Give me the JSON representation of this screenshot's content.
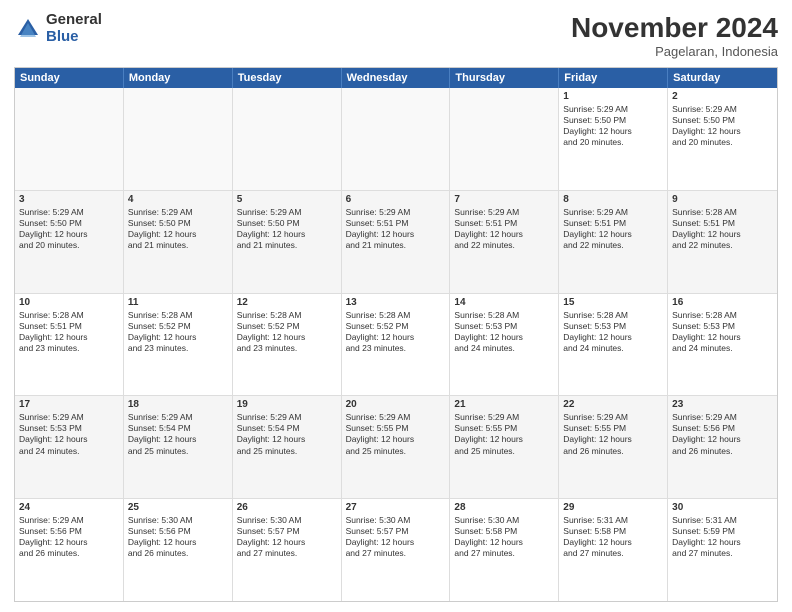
{
  "logo": {
    "general": "General",
    "blue": "Blue"
  },
  "header": {
    "title": "November 2024",
    "subtitle": "Pagelaran, Indonesia"
  },
  "weekdays": [
    "Sunday",
    "Monday",
    "Tuesday",
    "Wednesday",
    "Thursday",
    "Friday",
    "Saturday"
  ],
  "rows": [
    {
      "cells": [
        {
          "day": "",
          "text": "",
          "empty": true
        },
        {
          "day": "",
          "text": "",
          "empty": true
        },
        {
          "day": "",
          "text": "",
          "empty": true
        },
        {
          "day": "",
          "text": "",
          "empty": true
        },
        {
          "day": "",
          "text": "",
          "empty": true
        },
        {
          "day": "1",
          "text": "Sunrise: 5:29 AM\nSunset: 5:50 PM\nDaylight: 12 hours\nand 20 minutes.",
          "empty": false
        },
        {
          "day": "2",
          "text": "Sunrise: 5:29 AM\nSunset: 5:50 PM\nDaylight: 12 hours\nand 20 minutes.",
          "empty": false
        }
      ]
    },
    {
      "cells": [
        {
          "day": "3",
          "text": "Sunrise: 5:29 AM\nSunset: 5:50 PM\nDaylight: 12 hours\nand 20 minutes.",
          "empty": false
        },
        {
          "day": "4",
          "text": "Sunrise: 5:29 AM\nSunset: 5:50 PM\nDaylight: 12 hours\nand 21 minutes.",
          "empty": false
        },
        {
          "day": "5",
          "text": "Sunrise: 5:29 AM\nSunset: 5:50 PM\nDaylight: 12 hours\nand 21 minutes.",
          "empty": false
        },
        {
          "day": "6",
          "text": "Sunrise: 5:29 AM\nSunset: 5:51 PM\nDaylight: 12 hours\nand 21 minutes.",
          "empty": false
        },
        {
          "day": "7",
          "text": "Sunrise: 5:29 AM\nSunset: 5:51 PM\nDaylight: 12 hours\nand 22 minutes.",
          "empty": false
        },
        {
          "day": "8",
          "text": "Sunrise: 5:29 AM\nSunset: 5:51 PM\nDaylight: 12 hours\nand 22 minutes.",
          "empty": false
        },
        {
          "day": "9",
          "text": "Sunrise: 5:28 AM\nSunset: 5:51 PM\nDaylight: 12 hours\nand 22 minutes.",
          "empty": false
        }
      ]
    },
    {
      "cells": [
        {
          "day": "10",
          "text": "Sunrise: 5:28 AM\nSunset: 5:51 PM\nDaylight: 12 hours\nand 23 minutes.",
          "empty": false
        },
        {
          "day": "11",
          "text": "Sunrise: 5:28 AM\nSunset: 5:52 PM\nDaylight: 12 hours\nand 23 minutes.",
          "empty": false
        },
        {
          "day": "12",
          "text": "Sunrise: 5:28 AM\nSunset: 5:52 PM\nDaylight: 12 hours\nand 23 minutes.",
          "empty": false
        },
        {
          "day": "13",
          "text": "Sunrise: 5:28 AM\nSunset: 5:52 PM\nDaylight: 12 hours\nand 23 minutes.",
          "empty": false
        },
        {
          "day": "14",
          "text": "Sunrise: 5:28 AM\nSunset: 5:53 PM\nDaylight: 12 hours\nand 24 minutes.",
          "empty": false
        },
        {
          "day": "15",
          "text": "Sunrise: 5:28 AM\nSunset: 5:53 PM\nDaylight: 12 hours\nand 24 minutes.",
          "empty": false
        },
        {
          "day": "16",
          "text": "Sunrise: 5:28 AM\nSunset: 5:53 PM\nDaylight: 12 hours\nand 24 minutes.",
          "empty": false
        }
      ]
    },
    {
      "cells": [
        {
          "day": "17",
          "text": "Sunrise: 5:29 AM\nSunset: 5:53 PM\nDaylight: 12 hours\nand 24 minutes.",
          "empty": false
        },
        {
          "day": "18",
          "text": "Sunrise: 5:29 AM\nSunset: 5:54 PM\nDaylight: 12 hours\nand 25 minutes.",
          "empty": false
        },
        {
          "day": "19",
          "text": "Sunrise: 5:29 AM\nSunset: 5:54 PM\nDaylight: 12 hours\nand 25 minutes.",
          "empty": false
        },
        {
          "day": "20",
          "text": "Sunrise: 5:29 AM\nSunset: 5:55 PM\nDaylight: 12 hours\nand 25 minutes.",
          "empty": false
        },
        {
          "day": "21",
          "text": "Sunrise: 5:29 AM\nSunset: 5:55 PM\nDaylight: 12 hours\nand 25 minutes.",
          "empty": false
        },
        {
          "day": "22",
          "text": "Sunrise: 5:29 AM\nSunset: 5:55 PM\nDaylight: 12 hours\nand 26 minutes.",
          "empty": false
        },
        {
          "day": "23",
          "text": "Sunrise: 5:29 AM\nSunset: 5:56 PM\nDaylight: 12 hours\nand 26 minutes.",
          "empty": false
        }
      ]
    },
    {
      "cells": [
        {
          "day": "24",
          "text": "Sunrise: 5:29 AM\nSunset: 5:56 PM\nDaylight: 12 hours\nand 26 minutes.",
          "empty": false
        },
        {
          "day": "25",
          "text": "Sunrise: 5:30 AM\nSunset: 5:56 PM\nDaylight: 12 hours\nand 26 minutes.",
          "empty": false
        },
        {
          "day": "26",
          "text": "Sunrise: 5:30 AM\nSunset: 5:57 PM\nDaylight: 12 hours\nand 27 minutes.",
          "empty": false
        },
        {
          "day": "27",
          "text": "Sunrise: 5:30 AM\nSunset: 5:57 PM\nDaylight: 12 hours\nand 27 minutes.",
          "empty": false
        },
        {
          "day": "28",
          "text": "Sunrise: 5:30 AM\nSunset: 5:58 PM\nDaylight: 12 hours\nand 27 minutes.",
          "empty": false
        },
        {
          "day": "29",
          "text": "Sunrise: 5:31 AM\nSunset: 5:58 PM\nDaylight: 12 hours\nand 27 minutes.",
          "empty": false
        },
        {
          "day": "30",
          "text": "Sunrise: 5:31 AM\nSunset: 5:59 PM\nDaylight: 12 hours\nand 27 minutes.",
          "empty": false
        }
      ]
    }
  ]
}
